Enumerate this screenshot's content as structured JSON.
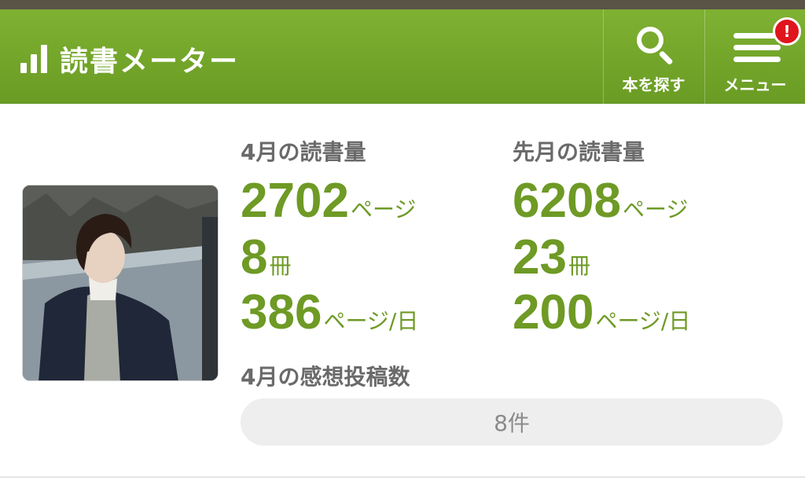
{
  "header": {
    "title": "読書メーター",
    "logo_icon": "signal-bars-icon",
    "bg_color": "#76a82c",
    "buttons": [
      {
        "label": "本を探す",
        "icon": "search-icon"
      },
      {
        "label": "メニュー",
        "icon": "hamburger-menu-icon"
      }
    ],
    "alert_badge": "!"
  },
  "user": {
    "avatar": "user-avatar"
  },
  "current_month": {
    "title": "4月の読書量",
    "pages": {
      "value": "2702",
      "unit": "ページ"
    },
    "books": {
      "value": "8",
      "unit": "冊"
    },
    "per_day": {
      "value": "386",
      "unit": "ページ/日"
    }
  },
  "last_month": {
    "title": "先月の読書量",
    "pages": {
      "value": "6208",
      "unit": "ページ"
    },
    "books": {
      "value": "23",
      "unit": "冊"
    },
    "per_day": {
      "value": "200",
      "unit": "ページ/日"
    }
  },
  "reviews": {
    "title": "4月の感想投稿数",
    "count_label": "8件"
  },
  "colors": {
    "accent_green": "#6e9a25",
    "label_gray": "#6a6a6a",
    "alert_red": "#e0141c"
  }
}
